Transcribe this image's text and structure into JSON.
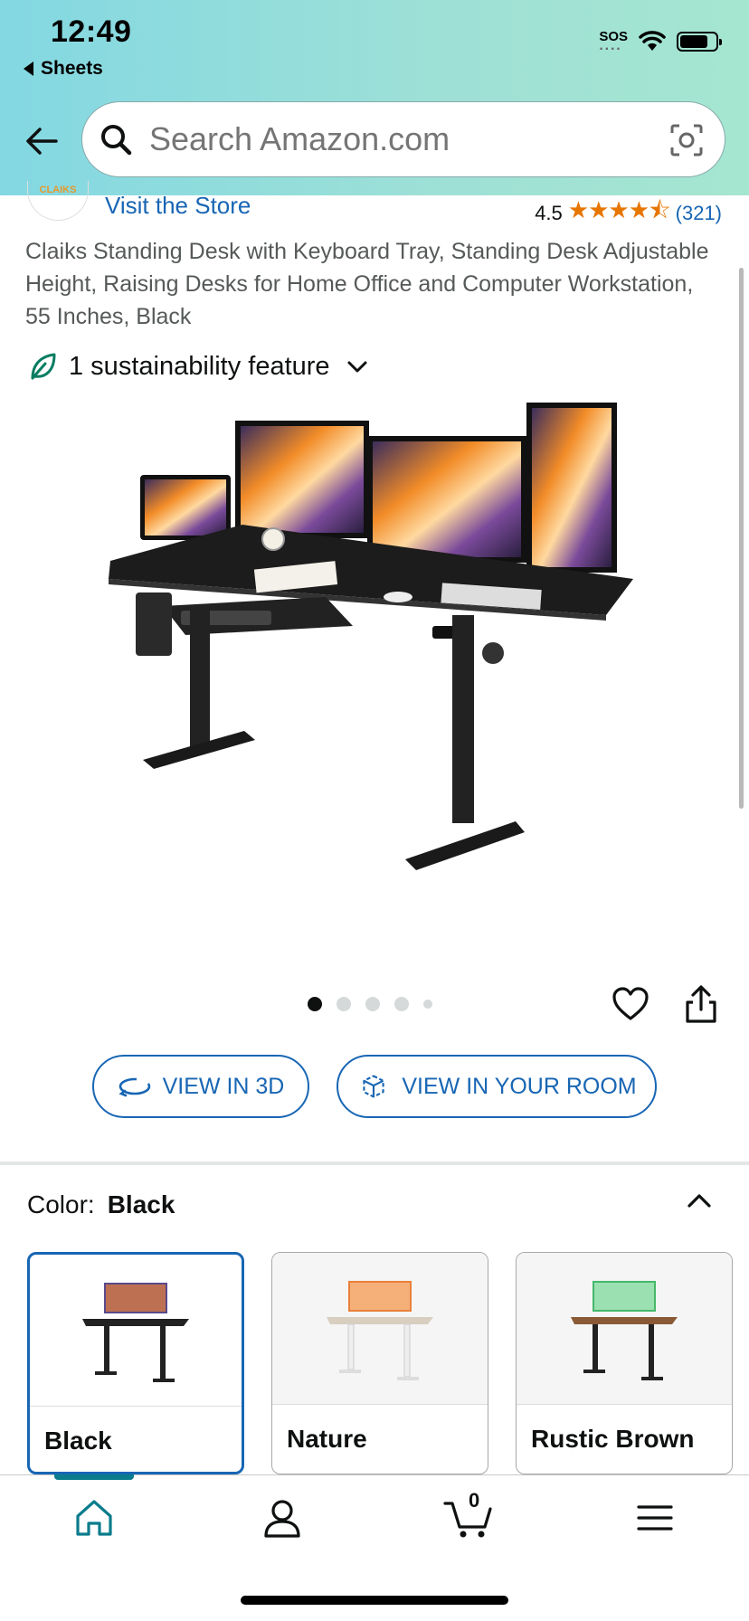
{
  "status_bar": {
    "time": "12:49",
    "back_app": "Sheets",
    "sos": "SOS"
  },
  "search": {
    "placeholder": "Search Amazon.com"
  },
  "store": {
    "logo_text": "CLAIKS",
    "visit_label": "Visit the Store"
  },
  "rating": {
    "value": "4.5",
    "stars": "★★★★⯪",
    "count": "(321)"
  },
  "product": {
    "title": "Claiks Standing Desk with Keyboard Tray, Standing Desk Adjustable Height, Raising Desks for Home Office and Computer Workstation, 55 Inches, Black",
    "sustainability": "1 sustainability feature"
  },
  "gallery": {
    "image_count": 5,
    "active_index": 0
  },
  "actions": {
    "view_3d": "VIEW IN 3D",
    "view_room": "VIEW IN YOUR ROOM"
  },
  "color": {
    "label": "Color:",
    "selected": "Black",
    "options": [
      {
        "name": "Black",
        "accent": "#5a4a8a"
      },
      {
        "name": "Nature",
        "accent": "#e8803a"
      },
      {
        "name": "Rustic Brown",
        "accent": "#45b86a"
      }
    ]
  },
  "bottom_nav": {
    "cart_count": "0",
    "items": [
      "home-icon",
      "account-icon",
      "cart-icon",
      "menu-icon"
    ]
  },
  "colors": {
    "link": "#1866b4",
    "star": "#e77600",
    "nav_active": "#0a7c8c"
  }
}
